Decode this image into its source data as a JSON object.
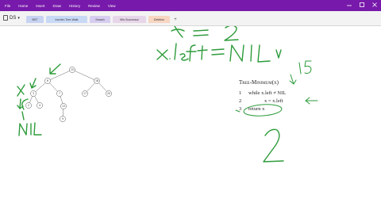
{
  "menu": [
    "File",
    "Home",
    "Insert",
    "Draw",
    "History",
    "Review",
    "View"
  ],
  "notebook": {
    "name": "DS",
    "arrow": "▾"
  },
  "tabs": [
    {
      "label": "BST",
      "color": "#c7d3f2"
    },
    {
      "label": "Inorder-Tree-Walk",
      "color": "#c8d9f6"
    },
    {
      "label": "Search",
      "color": "#d7cdf0"
    },
    {
      "label": "Min-Successor",
      "color": "#e7d6e9"
    },
    {
      "label": "Deletion",
      "color": "#f7d6c2"
    }
  ],
  "add_tab": "+",
  "tree": {
    "nodes": [
      "15",
      "6",
      "18",
      "3",
      "7",
      "17",
      "20",
      "2",
      "4",
      "13",
      "9"
    ]
  },
  "pseudocode": {
    "title": "Tree-Minimum(x)",
    "lines": [
      {
        "num": "1",
        "text": "while x.left ≠ NIL"
      },
      {
        "num": "2",
        "text": "x = x.left"
      },
      {
        "num": "3",
        "text": "return x"
      }
    ]
  },
  "handwriting": {
    "top": "x = 2",
    "left_nil": "x.left = NIL",
    "nil_label": "NIL",
    "fifteen": "15",
    "big_two": "2"
  },
  "colors": {
    "ribbon": "#7719aa",
    "ink": "#2d9b3a"
  }
}
